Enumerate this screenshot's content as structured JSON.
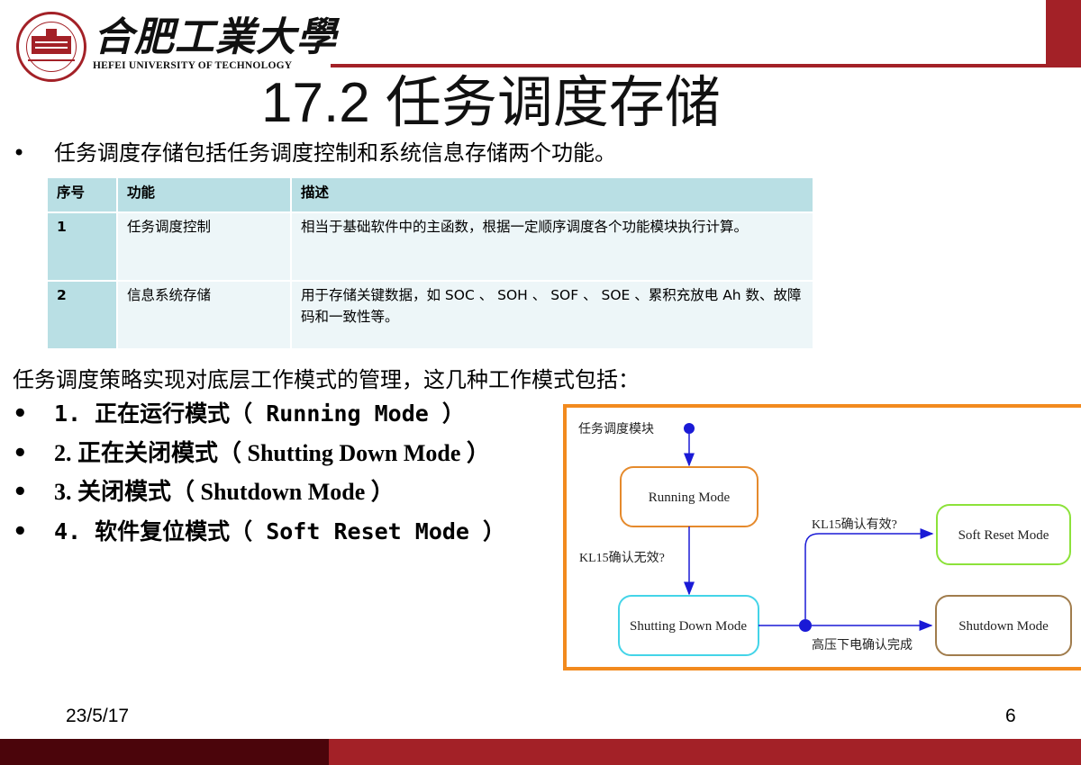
{
  "header": {
    "logo_cn": "合肥工業大學",
    "logo_en": "HEFEI UNIVERSITY OF TECHNOLOGY",
    "seal_icon": "university-seal-icon",
    "accent_color": "#a32127",
    "footer_dark_color": "#4b050b"
  },
  "slide": {
    "title": "17.2 任务调度存储",
    "intro_bullet": "•",
    "intro": "任务调度存储包括任务调度控制和系统信息存储两个功能。",
    "table": {
      "headers": [
        "序号",
        "功能",
        "描述"
      ],
      "rows": [
        {
          "no": "1",
          "func": "任务调度控制",
          "desc": "相当于基础软件中的主函数，根据一定顺序调度各个功能模块执行计算。"
        },
        {
          "no": "2",
          "func": "信息系统存储",
          "desc": "用于存储关键数据，如 SOC 、 SOH 、 SOF 、 SOE 、累积充放电 Ah 数、故障码和一致性等。"
        }
      ]
    },
    "modes_intro": "任务调度策略实现对底层工作模式的管理，这几种工作模式包括：",
    "modes": [
      {
        "bullet": "•",
        "label": "1. 正在运行模式（ Running Mode ）"
      },
      {
        "bullet": "•",
        "label": "2. 正在关闭模式（ Shutting Down Mode ）"
      },
      {
        "bullet": "•",
        "label": "3. 关闭模式（ Shutdown Mode ）"
      },
      {
        "bullet": "•",
        "label": "4. 软件复位模式（ Soft Reset Mode ）"
      }
    ],
    "diagram": {
      "start_label": "任务调度模块",
      "states": {
        "running": "Running Mode",
        "shutting_down": "Shutting Down Mode",
        "soft_reset": "Soft Reset Mode",
        "shutdown": "Shutdown Mode"
      },
      "transitions": {
        "running_to_shutting": "KL15确认无效?",
        "to_soft_reset": "KL15确认有效?",
        "to_shutdown": "高压下电确认完成"
      },
      "colors": {
        "frame": "#f28a1e",
        "arrow": "#1a1ad6",
        "running": "#e58a2c",
        "shutting_down": "#44d4e8",
        "soft_reset": "#8ce23a",
        "shutdown": "#a07c4c"
      }
    }
  },
  "footer": {
    "date": "23/5/17",
    "page": "6"
  }
}
